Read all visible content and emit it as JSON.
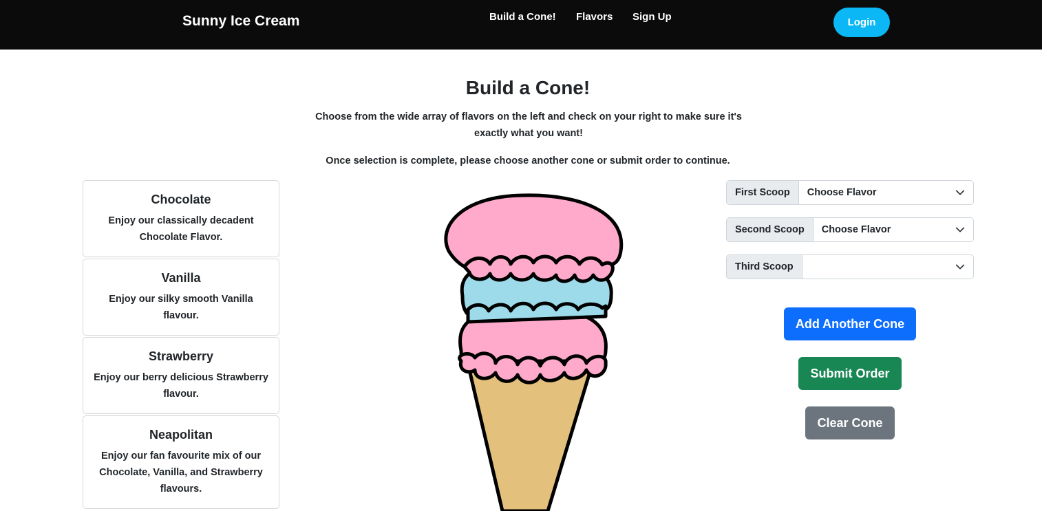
{
  "nav": {
    "brand": "Sunny Ice Cream",
    "links": [
      "Build a Cone!",
      "Flavors",
      "Sign Up"
    ],
    "login": "Login"
  },
  "header": {
    "title": "Build a Cone!",
    "intro": "Choose from the wide array of flavors on the left and check on your right to make sure it's exactly what you want!",
    "instruction": "Once selection is complete, please choose another cone or submit order to continue."
  },
  "flavors": [
    {
      "name": "Chocolate",
      "description": "Enjoy our classically decadent Chocolate Flavor."
    },
    {
      "name": "Vanilla",
      "description": "Enjoy our silky smooth Vanilla flavour."
    },
    {
      "name": "Strawberry",
      "description": "Enjoy our berry delicious Strawberry flavour."
    },
    {
      "name": "Neapolitan",
      "description": "Enjoy our fan favourite mix of our Chocolate, Vanilla, and Strawberry flavours."
    }
  ],
  "scoops": [
    {
      "label": "First Scoop",
      "value": "Choose Flavor"
    },
    {
      "label": "Second Scoop",
      "value": "Choose Flavor"
    },
    {
      "label": "Third Scoop",
      "value": ""
    }
  ],
  "actions": {
    "add": "Add Another Cone",
    "submit": "Submit Order",
    "clear": "Clear Cone"
  },
  "colors": {
    "primary": "#0d6efd",
    "success": "#198754",
    "secondary": "#6c757d",
    "login": "#0bb8f5",
    "scoop_pink": "#ffaacb",
    "scoop_blue": "#9ddbeb",
    "cone": "#e3c07c"
  }
}
